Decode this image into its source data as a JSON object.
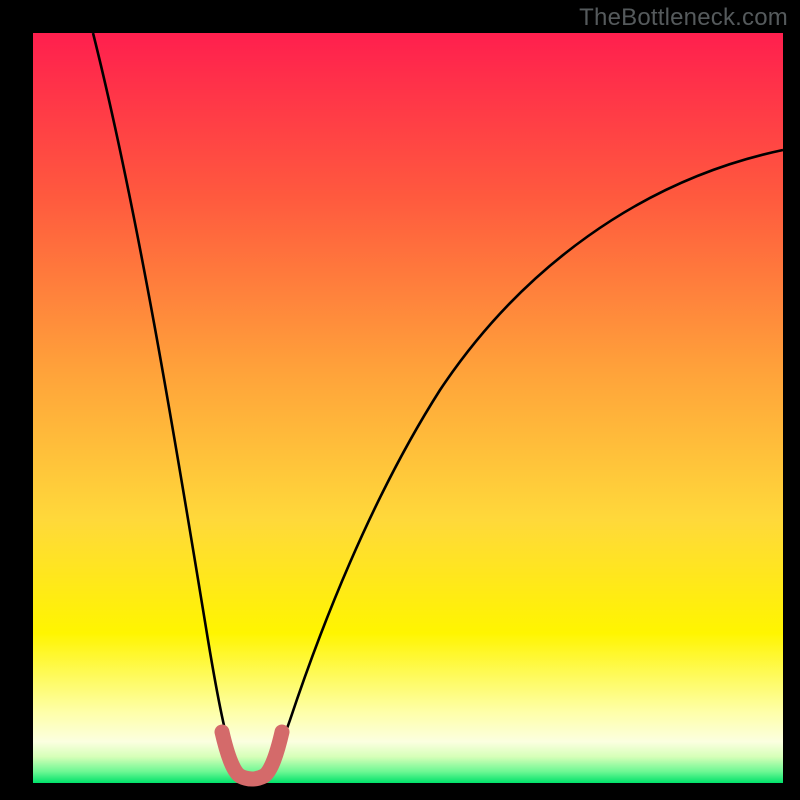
{
  "attribution": "TheBottleneck.com",
  "colors": {
    "page_bg": "#000000",
    "gradient_top": "#ff1f4e",
    "gradient_mid1": "#ff6a3a",
    "gradient_mid2": "#ffb63a",
    "gradient_mid3": "#fff500",
    "gradient_mid4": "#fdffb0",
    "gradient_bottom": "#00e86a",
    "curve_stroke": "#000000",
    "marker_stroke": "#d46a6a"
  },
  "chart_data": {
    "type": "line",
    "title": "",
    "xlabel": "",
    "ylabel": "",
    "xlim": [
      0,
      100
    ],
    "ylim": [
      0,
      100
    ],
    "series": [
      {
        "name": "left-branch",
        "x": [
          8,
          10,
          12,
          14,
          16,
          18,
          20,
          22,
          24,
          25.5,
          27
        ],
        "y": [
          100,
          88,
          76,
          64,
          52,
          40,
          29,
          19,
          10,
          5,
          1.2
        ]
      },
      {
        "name": "right-branch",
        "x": [
          31,
          33,
          36,
          40,
          45,
          51,
          58,
          66,
          75,
          85,
          95,
          100
        ],
        "y": [
          1.2,
          6,
          14,
          24,
          35,
          46,
          56,
          64,
          71,
          76.5,
          80.5,
          82
        ]
      },
      {
        "name": "highlighted-valley",
        "x": [
          25.5,
          26.2,
          27,
          28,
          29,
          30,
          31,
          31.8,
          32.5
        ],
        "y": [
          5,
          2.5,
          1.2,
          0.6,
          0.5,
          0.6,
          1.2,
          2.5,
          5
        ]
      }
    ],
    "markers": {
      "series": "highlighted-valley",
      "shape": "round",
      "color": "#d46a6a"
    }
  }
}
